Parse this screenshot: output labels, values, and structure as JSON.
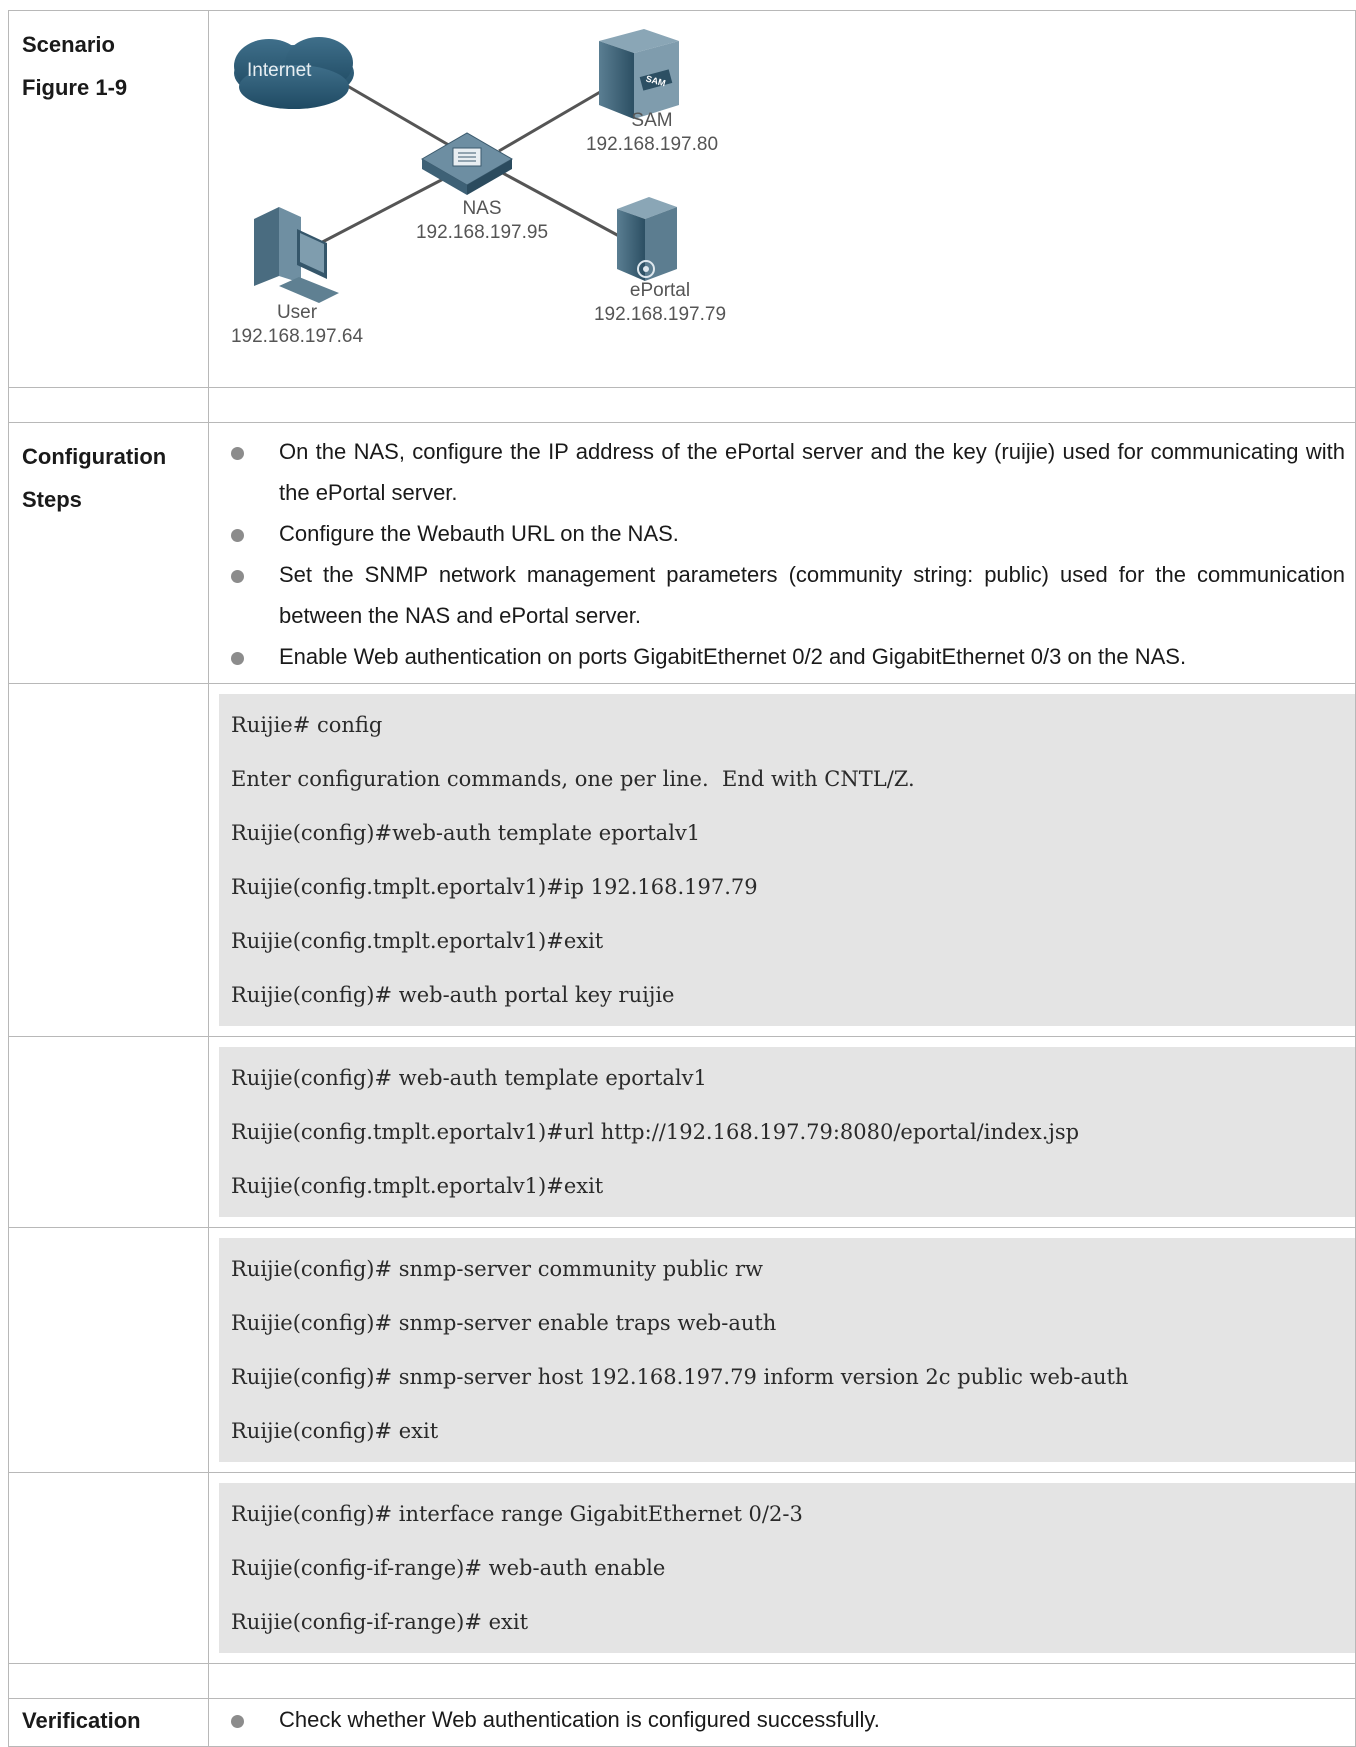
{
  "rows": {
    "scenario": {
      "label_line1": "Scenario",
      "label_line2": "Figure 1-9"
    },
    "config_steps": {
      "label_line1": "Configuration",
      "label_line2": "Steps"
    },
    "verification": {
      "label": "Verification"
    }
  },
  "diagram": {
    "internet": "Internet",
    "sam": {
      "name": "SAM",
      "ip": "192.168.197.80",
      "badge": "SAM"
    },
    "nas": {
      "name": "NAS",
      "ip": "192.168.197.95"
    },
    "user": {
      "name": "User",
      "ip": "192.168.197.64"
    },
    "eportal": {
      "name": "ePortal",
      "ip": "192.168.197.79"
    }
  },
  "steps": [
    "On the NAS, configure the IP address of the ePortal server and the key (ruijie) used for communicating with the ePortal server.",
    "Configure the Webauth URL on the NAS.",
    "Set the SNMP network management parameters (community string: public) used for the communication between the NAS and ePortal server.",
    "Enable Web authentication on ports GigabitEthernet 0/2 and GigabitEthernet 0/3 on the NAS."
  ],
  "code_blocks": [
    [
      "Ruijie# config",
      "Enter configuration commands, one per line.  End with CNTL/Z.",
      "Ruijie(config)#web-auth template eportalv1",
      "Ruijie(config.tmplt.eportalv1)#ip 192.168.197.79",
      "Ruijie(config.tmplt.eportalv1)#exit",
      "Ruijie(config)# web-auth portal key ruijie"
    ],
    [
      "Ruijie(config)# web-auth template eportalv1",
      "Ruijie(config.tmplt.eportalv1)#url http://192.168.197.79:8080/eportal/index.jsp",
      "Ruijie(config.tmplt.eportalv1)#exit"
    ],
    [
      "Ruijie(config)# snmp-server community public rw",
      "Ruijie(config)# snmp-server enable traps web-auth",
      "Ruijie(config)# snmp-server host 192.168.197.79 inform version 2c public web-auth",
      "Ruijie(config)# exit"
    ],
    [
      "Ruijie(config)# interface range GigabitEthernet 0/2-3",
      "Ruijie(config-if-range)# web-auth enable",
      "Ruijie(config-if-range)# exit"
    ]
  ],
  "verification_steps": [
    "Check whether Web authentication is configured successfully."
  ]
}
